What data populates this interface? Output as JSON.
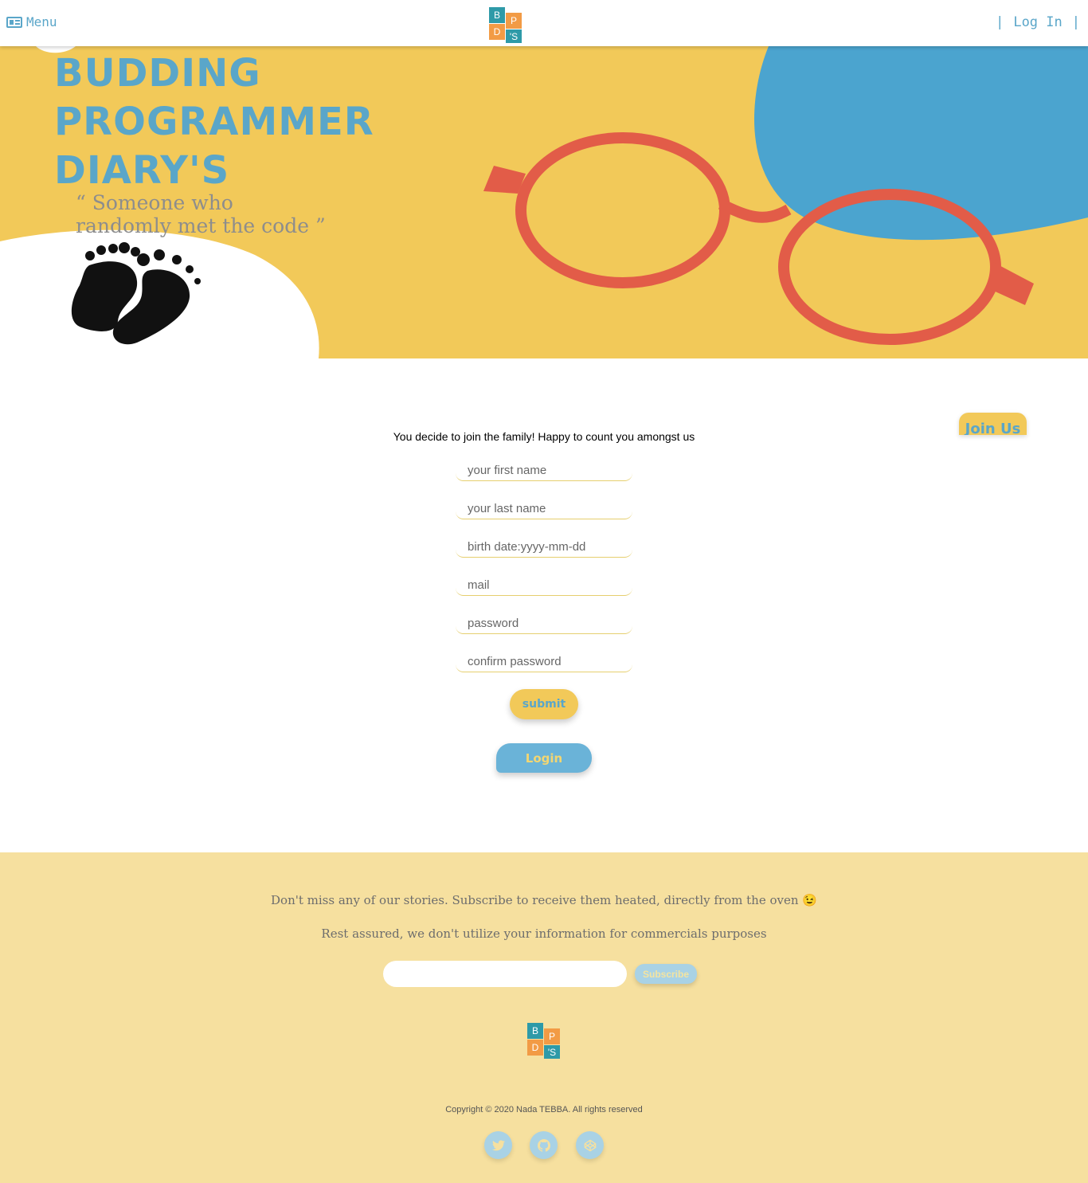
{
  "header": {
    "menu_label": "Menu",
    "login_label": "Log In",
    "login_separator": "|"
  },
  "logo": {
    "b": "B",
    "p": "P",
    "d": "D",
    "s": "'S"
  },
  "hero": {
    "title_line1": "BUDDING",
    "title_line2": "PROGRAMMER",
    "title_line3": "DIARY'S",
    "quote": "“ Someone who randomly met the code ”"
  },
  "main": {
    "join_tab": "Join Us",
    "intro": "You decide to join the family! Happy to count you amongst us",
    "fields": {
      "first_name": "your first name",
      "last_name": "your last name",
      "birth_date": "birth date:yyyy-mm-dd",
      "mail": "mail",
      "password": "password",
      "confirm_password": "confirm password"
    },
    "submit_label": "submit",
    "login_label": "Login"
  },
  "footer": {
    "line1": "Don't miss any of our stories. Subscribe to receive them heated, directly from the oven 😉",
    "line2": "Rest assured, we don't utilize your information for commercials purposes",
    "subscribe_label": "Subscribe",
    "copyright": "Copyright © 2020 Nada TEBBA. All rights reserved",
    "social": [
      "twitter-icon",
      "github-icon",
      "codepen-icon"
    ]
  },
  "colors": {
    "accent_blue": "#5aa6c9",
    "hero_yellow": "#f2c959",
    "footer_yellow": "#f6e09f",
    "glasses_red": "#e25c48"
  }
}
